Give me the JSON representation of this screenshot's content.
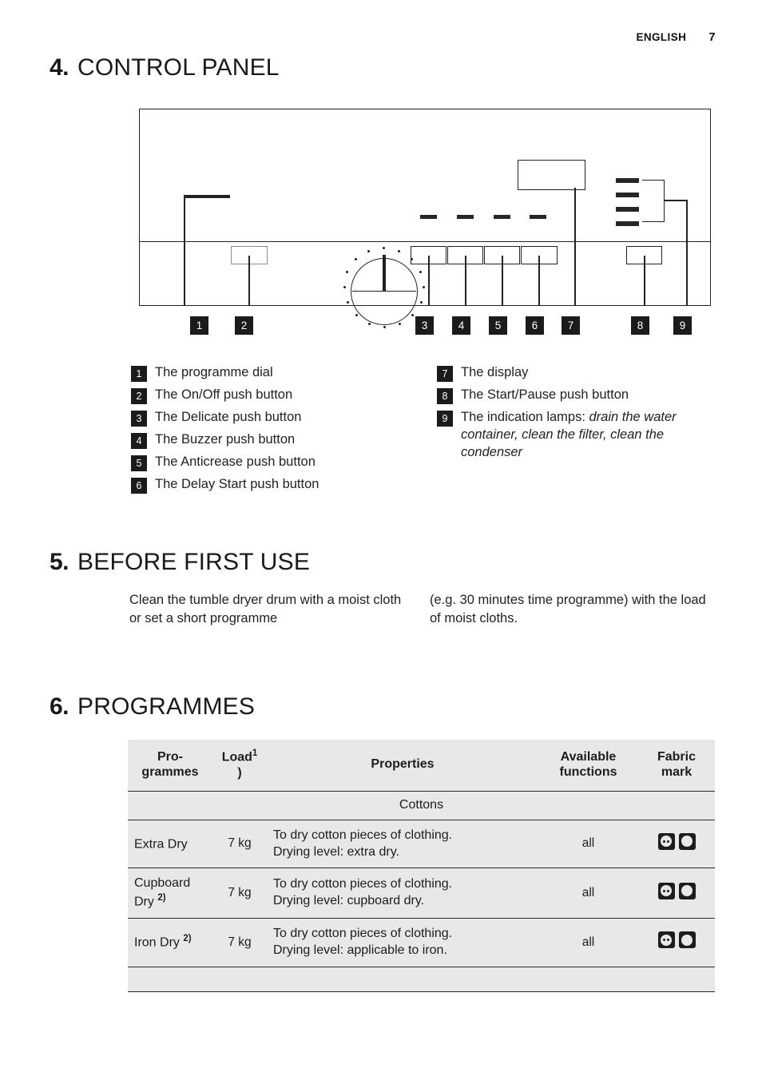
{
  "header": {
    "language": "ENGLISH",
    "page_number": "7"
  },
  "sections": {
    "control_panel": {
      "number": "4.",
      "title": "CONTROL PANEL"
    },
    "before_first_use": {
      "number": "5.",
      "title": "BEFORE FIRST USE"
    },
    "programmes": {
      "number": "6.",
      "title": "PROGRAMMES"
    }
  },
  "callout_numbers": [
    "1",
    "2",
    "3",
    "4",
    "5",
    "6",
    "7",
    "8",
    "9"
  ],
  "legend_left": [
    {
      "num": "1",
      "text": "The programme dial"
    },
    {
      "num": "2",
      "text": "The On/Off push button"
    },
    {
      "num": "3",
      "text": "The Delicate push button"
    },
    {
      "num": "4",
      "text": "The Buzzer push button"
    },
    {
      "num": "5",
      "text": "The Anticrease push button"
    },
    {
      "num": "6",
      "text": "The Delay Start push button"
    }
  ],
  "legend_right": [
    {
      "num": "7",
      "text": "The display",
      "italic": ""
    },
    {
      "num": "8",
      "text": "The Start/Pause push button",
      "italic": ""
    },
    {
      "num": "9",
      "text": "The indication lamps: ",
      "italic": "drain the water container, clean the filter, clean the condenser"
    }
  ],
  "before_first_use_body": {
    "column_1": "Clean the tumble dryer drum with a moist cloth or set a short programme",
    "column_2": "(e.g. 30 minutes time programme) with the load of moist cloths."
  },
  "programmes_table": {
    "headers": {
      "programmes": "Pro-\ngrammes",
      "programmes_l1": "Pro-",
      "programmes_l2": "grammes",
      "load": "Load",
      "load_sup": "1",
      "load_sup_close": ")",
      "properties": "Properties",
      "available_functions_l1": "Available",
      "available_functions_l2": "functions",
      "fabric_mark_l1": "Fabric",
      "fabric_mark_l2": "mark"
    },
    "group_row": "Cottons",
    "rows": [
      {
        "programme": "Extra Dry",
        "programme_sup": "",
        "load": "7 kg",
        "properties_l1": "To dry cotton pieces of clothing.",
        "properties_l2": "Drying level: extra dry.",
        "functions": "all",
        "marks": [
          "tumble-dry-normal",
          "tumble-dry-any"
        ]
      },
      {
        "programme": "Cupboard Dry",
        "programme_sup": "2)",
        "load": "7 kg",
        "properties_l1": "To dry cotton pieces of clothing.",
        "properties_l2": "Drying level: cupboard dry.",
        "functions": "all",
        "marks": [
          "tumble-dry-normal",
          "tumble-dry-any"
        ]
      },
      {
        "programme": "Iron Dry",
        "programme_sup": "2)",
        "load": "7 kg",
        "properties_l1": "To dry cotton pieces of clothing.",
        "properties_l2": "Drying level: applicable to iron.",
        "functions": "all",
        "marks": [
          "tumble-dry-normal",
          "tumble-dry-any"
        ]
      }
    ]
  },
  "colors": {
    "ink": "#1d1d1d",
    "table_fill": "#e8e8e8",
    "badge": "#1b1b1b"
  }
}
